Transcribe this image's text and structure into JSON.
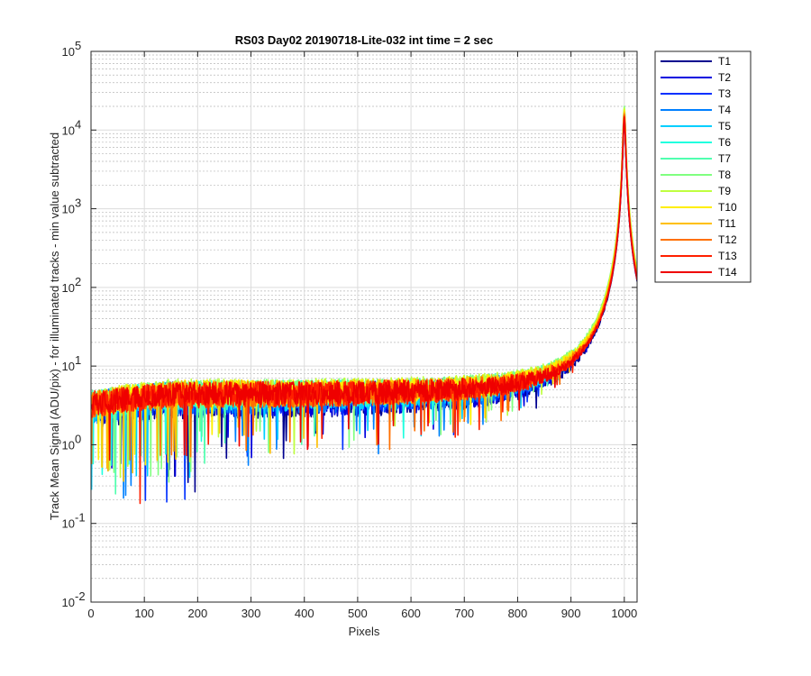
{
  "chart_data": {
    "type": "line",
    "title": "RS03 Day02 20190718-Lite-032 int time = 2 sec",
    "xlabel": "Pixels",
    "ylabel": "Track Mean Signal (ADU/pix) - for illuminated tracks - min value subtracted",
    "xlim": [
      0,
      1024
    ],
    "ylim": [
      0.01,
      100000
    ],
    "yscale": "log",
    "grid": true,
    "minor_grid": true,
    "legend_location": "outside-top-right",
    "x_ticks": [
      "0",
      "100",
      "200",
      "300",
      "400",
      "500",
      "600",
      "700",
      "800",
      "900",
      "1000"
    ],
    "y_ticks": [
      {
        "base": "10",
        "exp": "-2"
      },
      {
        "base": "10",
        "exp": "-1"
      },
      {
        "base": "10",
        "exp": "0"
      },
      {
        "base": "10",
        "exp": "1"
      },
      {
        "base": "10",
        "exp": "2"
      },
      {
        "base": "10",
        "exp": "3"
      },
      {
        "base": "10",
        "exp": "4"
      },
      {
        "base": "10",
        "exp": "5"
      }
    ],
    "series": [
      {
        "name": "T1",
        "color": "#00008f",
        "baseline": 3.5,
        "noise": 0.55,
        "peak": 14000
      },
      {
        "name": "T2",
        "color": "#0000df",
        "baseline": 3.6,
        "noise": 0.55,
        "peak": 15000
      },
      {
        "name": "T3",
        "color": "#0030ff",
        "baseline": 3.7,
        "noise": 0.5,
        "peak": 15500
      },
      {
        "name": "T4",
        "color": "#0080ff",
        "baseline": 3.8,
        "noise": 0.5,
        "peak": 16000
      },
      {
        "name": "T5",
        "color": "#00cfff",
        "baseline": 3.9,
        "noise": 0.45,
        "peak": 17000
      },
      {
        "name": "T6",
        "color": "#20ffdf",
        "baseline": 4.1,
        "noise": 0.45,
        "peak": 18000
      },
      {
        "name": "T7",
        "color": "#50ffaf",
        "baseline": 4.3,
        "noise": 0.4,
        "peak": 19000
      },
      {
        "name": "T8",
        "color": "#80ff80",
        "baseline": 4.4,
        "noise": 0.4,
        "peak": 20000
      },
      {
        "name": "T9",
        "color": "#bfff40",
        "baseline": 4.5,
        "noise": 0.4,
        "peak": 19000
      },
      {
        "name": "T10",
        "color": "#ffef00",
        "baseline": 4.4,
        "noise": 0.4,
        "peak": 18000
      },
      {
        "name": "T11",
        "color": "#ffbf00",
        "baseline": 4.3,
        "noise": 0.4,
        "peak": 17000
      },
      {
        "name": "T12",
        "color": "#ff7000",
        "baseline": 4.2,
        "noise": 0.4,
        "peak": 16000
      },
      {
        "name": "T13",
        "color": "#ff2000",
        "baseline": 4.2,
        "noise": 0.4,
        "peak": 15000
      },
      {
        "name": "T14",
        "color": "#ef0000",
        "baseline": 4.3,
        "noise": 0.35,
        "peak": 14500
      }
    ],
    "peak_x": 1000
  }
}
